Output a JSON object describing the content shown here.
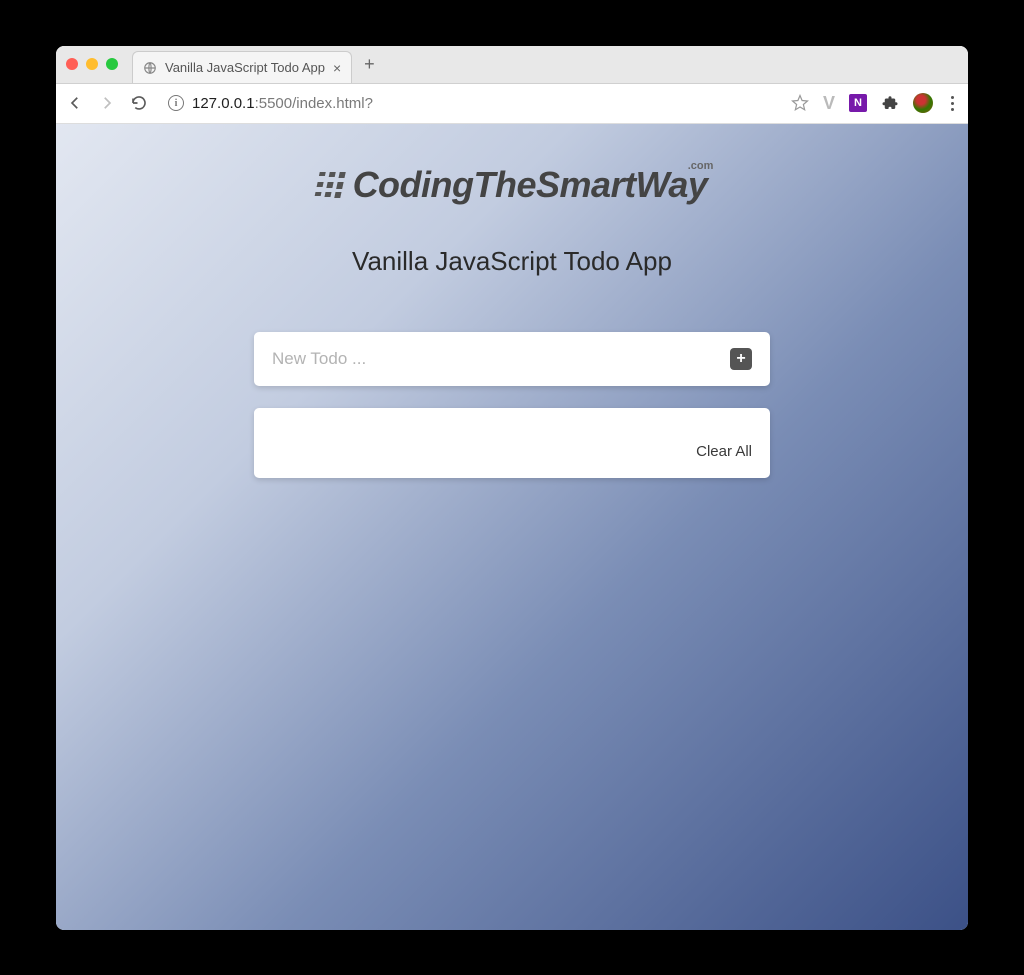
{
  "browser": {
    "tab_title": "Vanilla JavaScript Todo App",
    "url_host": "127.0.0.1",
    "url_port_path": ":5500/index.html?"
  },
  "page": {
    "logo_text": "CodingTheSmartWay",
    "logo_suffix": ".com",
    "heading": "Vanilla JavaScript Todo App",
    "input_placeholder": "New Todo ...",
    "clear_label": "Clear All"
  }
}
